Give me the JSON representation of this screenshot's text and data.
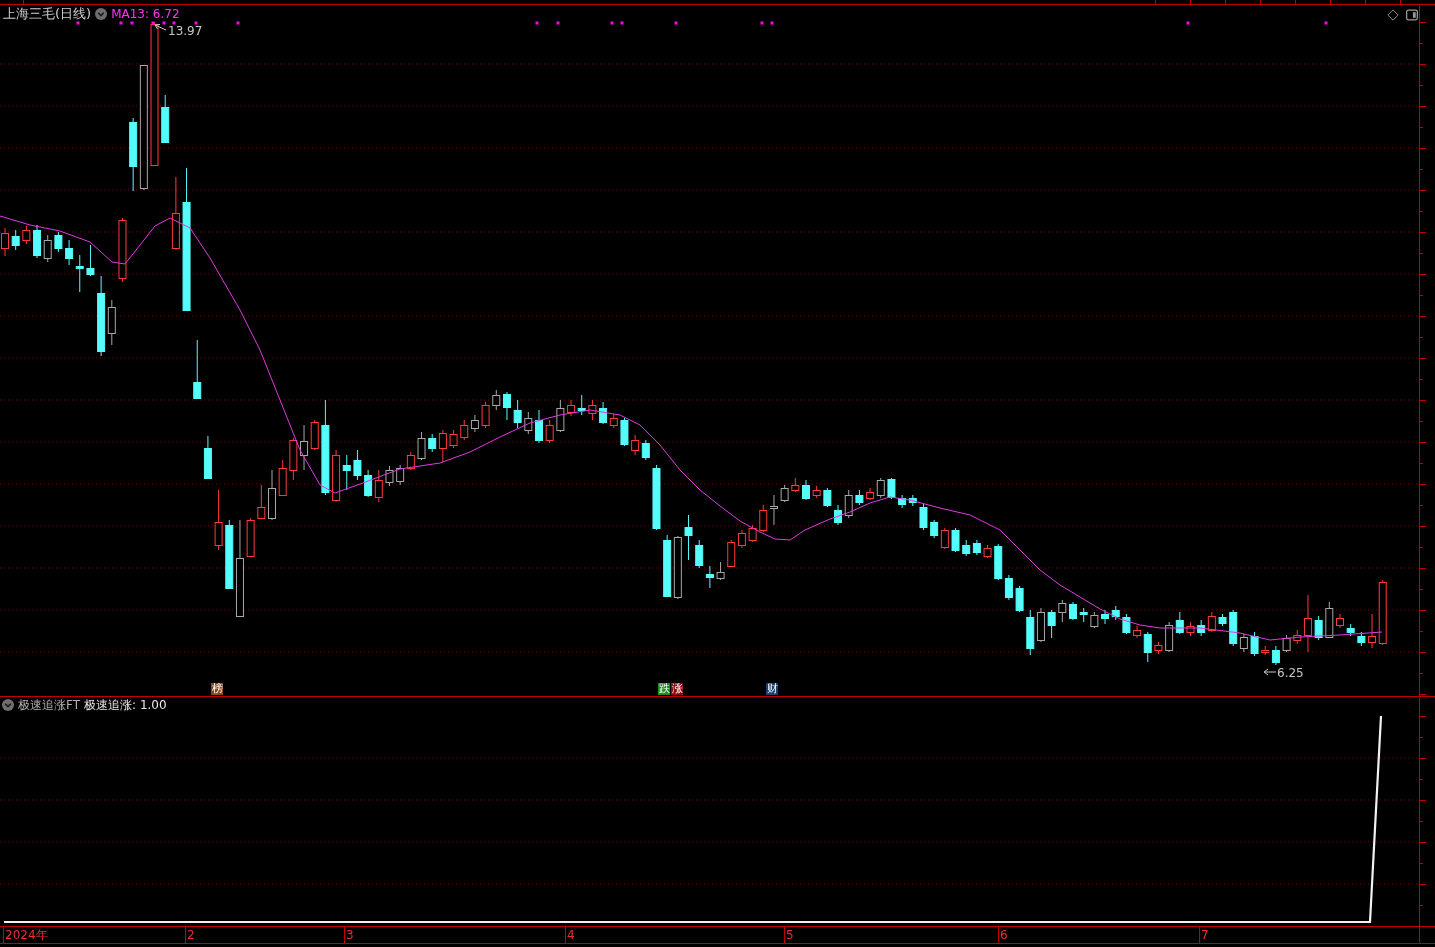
{
  "price_chart": {
    "title": "上海三毛(日线)",
    "moving_average": "MA13: 6.72",
    "high_label": "13.97",
    "low_label": "6.25",
    "event_badges": [
      {
        "text": "榜",
        "color": "#8b4513"
      },
      {
        "text": "跌",
        "color": "#1e8a1e"
      },
      {
        "text": "涨",
        "color": "#8a0c0c"
      },
      {
        "text": "财",
        "color": "#173f6e"
      }
    ]
  },
  "indicator_panel": {
    "name": "极速追涨FT",
    "reading": "极速追涨: 1.00"
  },
  "x_axis": {
    "labels": [
      "2024年",
      "2",
      "3",
      "4",
      "5",
      "6",
      "7"
    ]
  }
}
